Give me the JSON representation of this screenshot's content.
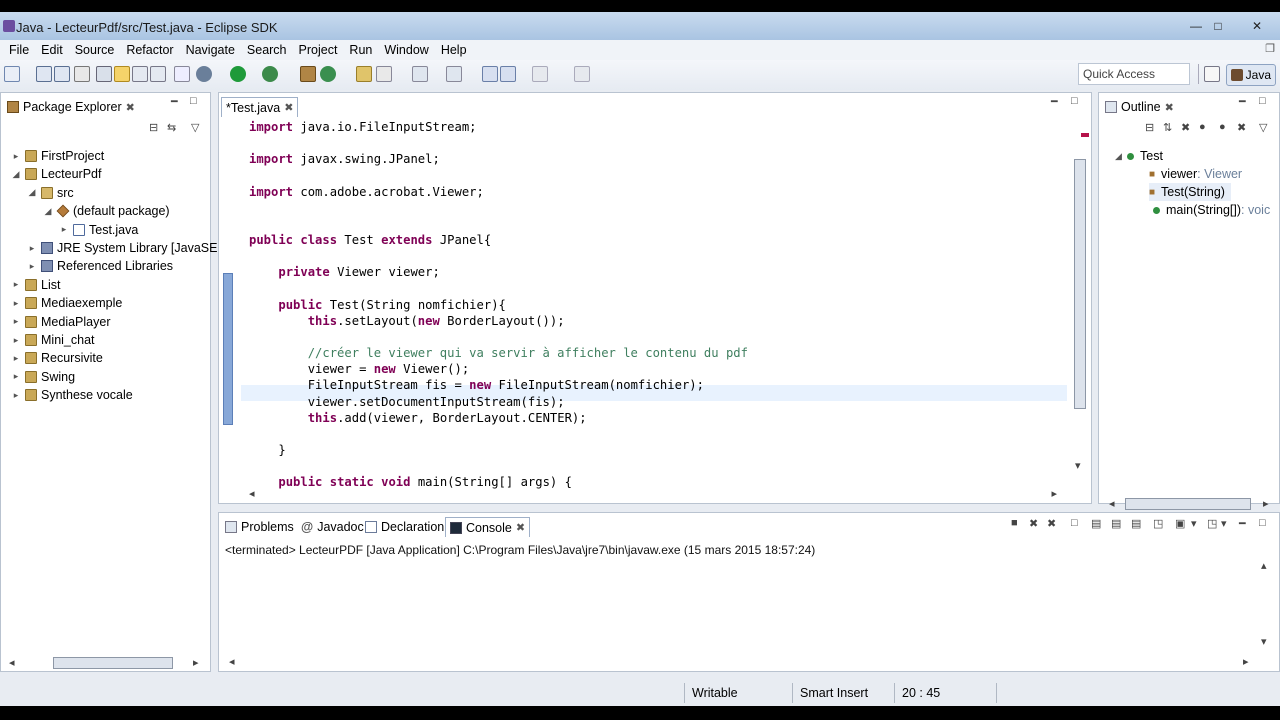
{
  "window": {
    "title": "Java - LecteurPdf/src/Test.java - Eclipse SDK",
    "controls": {
      "minimize": "—",
      "maximize": "□",
      "close": "✕"
    }
  },
  "menu": [
    "File",
    "Edit",
    "Source",
    "Refactor",
    "Navigate",
    "Search",
    "Project",
    "Run",
    "Window",
    "Help"
  ],
  "toolbar": {
    "quick_access_placeholder": "Quick Access",
    "perspective": "Java"
  },
  "package_explorer": {
    "title": "Package Explorer",
    "items": [
      {
        "label": "FirstProject",
        "level": 0,
        "expanded": false,
        "icon": "project-icon"
      },
      {
        "label": "LecteurPdf",
        "level": 0,
        "expanded": true,
        "icon": "project-icon"
      },
      {
        "label": "src",
        "level": 1,
        "expanded": true,
        "icon": "source-folder-icon"
      },
      {
        "label": "(default package)",
        "level": 2,
        "expanded": true,
        "icon": "package-icon"
      },
      {
        "label": "Test.java",
        "level": 3,
        "expanded": false,
        "icon": "java-file-icon"
      },
      {
        "label": "JRE System Library [JavaSE-1",
        "level": 1,
        "expanded": false,
        "icon": "library-icon"
      },
      {
        "label": "Referenced Libraries",
        "level": 1,
        "expanded": false,
        "icon": "library-icon"
      },
      {
        "label": "List",
        "level": 0,
        "expanded": false,
        "icon": "project-icon"
      },
      {
        "label": "Mediaexemple",
        "level": 0,
        "expanded": false,
        "icon": "project-icon"
      },
      {
        "label": "MediaPlayer",
        "level": 0,
        "expanded": false,
        "icon": "project-icon"
      },
      {
        "label": "Mini_chat",
        "level": 0,
        "expanded": false,
        "icon": "project-icon"
      },
      {
        "label": "Recursivite",
        "level": 0,
        "expanded": false,
        "icon": "project-icon"
      },
      {
        "label": "Swing",
        "level": 0,
        "expanded": false,
        "icon": "project-icon"
      },
      {
        "label": "Synthese vocale",
        "level": 0,
        "expanded": false,
        "icon": "project-icon"
      }
    ]
  },
  "editor": {
    "tab": "*Test.java",
    "lines": [
      "import java.io.FileInputStream;",
      "",
      "import javax.swing.JPanel;",
      "",
      "import com.adobe.acrobat.Viewer;",
      "",
      "",
      "public class Test extends JPanel{",
      "",
      "    private Viewer viewer;",
      "",
      "    public Test(String nomfichier){",
      "        this.setLayout(new BorderLayout());",
      "",
      "        //créer le viewer qui va servir à afficher le contenu du pdf",
      "        viewer = new Viewer();",
      "        FileInputStream fis = new FileInputStream(nomfichier);",
      "        viewer.setDocumentInputStream(fis);",
      "        this.add(viewer, BorderLayout.CENTER);",
      "",
      "    }",
      "",
      "    public static void main(String[] args) {"
    ]
  },
  "outline": {
    "title": "Outline",
    "items": [
      {
        "label": "Test",
        "detail": ""
      },
      {
        "label": "viewer",
        "detail": " : Viewer"
      },
      {
        "label": "Test(String)",
        "detail": ""
      },
      {
        "label": "main(String[])",
        "detail": " : voic"
      }
    ]
  },
  "bottom": {
    "tabs": [
      "Problems",
      "Javadoc",
      "Declaration",
      "Console"
    ],
    "active_tab": "Console",
    "console_text": "<terminated> LecteurPDF [Java Application] C:\\Program Files\\Java\\jre7\\bin\\javaw.exe (15 mars 2015 18:57:24)"
  },
  "status": {
    "writable": "Writable",
    "insert_mode": "Smart Insert",
    "position": "20 : 45"
  }
}
